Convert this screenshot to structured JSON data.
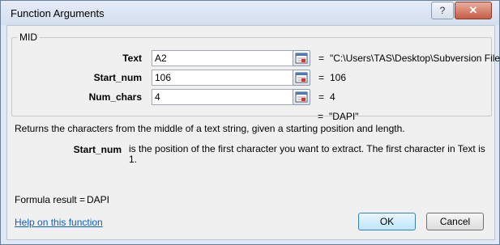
{
  "window": {
    "title": "Function Arguments",
    "help_button": "?",
    "close_button": "✕"
  },
  "function_name": "MID",
  "arguments": [
    {
      "label": "Text",
      "value": "A2",
      "result": "\"C:\\Users\\TAS\\Desktop\\Subversion Files"
    },
    {
      "label": "Start_num",
      "value": "106",
      "result": "106"
    },
    {
      "label": "Num_chars",
      "value": "4",
      "result": "4"
    }
  ],
  "equals_sign": "=",
  "function_result": "\"DAPI\"",
  "description": "Returns the characters from the middle of a text string, given a starting position and length.",
  "argument_help": {
    "name": "Start_num",
    "text": "is the position of the first character you want to extract. The first character in Text is 1."
  },
  "formula_result": {
    "label": "Formula result =",
    "value": "DAPI"
  },
  "help_link": "Help on this function",
  "buttons": {
    "ok": "OK",
    "cancel": "Cancel"
  },
  "icons": {
    "ref": "collapse-dialog-icon"
  }
}
